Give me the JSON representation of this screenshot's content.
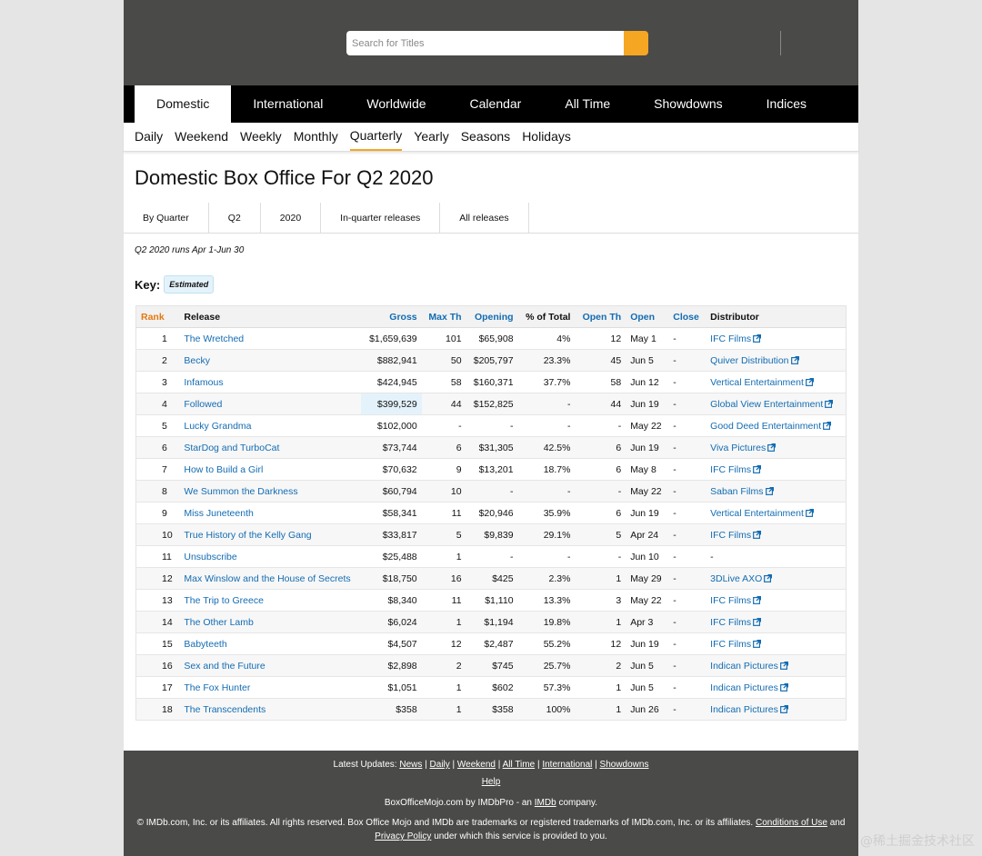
{
  "search": {
    "placeholder": "Search for Titles"
  },
  "nav_main": [
    "Domestic",
    "International",
    "Worldwide",
    "Calendar",
    "All Time",
    "Showdowns",
    "Indices"
  ],
  "nav_sub": [
    "Daily",
    "Weekend",
    "Weekly",
    "Monthly",
    "Quarterly",
    "Yearly",
    "Seasons",
    "Holidays"
  ],
  "page_title": "Domestic Box Office For Q2 2020",
  "filters": [
    "By Quarter",
    "Q2",
    "2020",
    "In-quarter releases",
    "All releases"
  ],
  "note": "Q2 2020 runs Apr 1-Jun 30",
  "key": {
    "label": "Key:",
    "badge": "Estimated"
  },
  "table": {
    "headers": [
      "Rank",
      "Release",
      "Gross",
      "Max Th",
      "Opening",
      "% of Total",
      "Open Th",
      "Open",
      "Close",
      "Distributor"
    ],
    "rows": [
      [
        "1",
        "The Wretched",
        "$1,659,639",
        "101",
        "$65,908",
        "4%",
        "12",
        "May 1",
        "-",
        "IFC Films"
      ],
      [
        "2",
        "Becky",
        "$882,941",
        "50",
        "$205,797",
        "23.3%",
        "45",
        "Jun 5",
        "-",
        "Quiver Distribution"
      ],
      [
        "3",
        "Infamous",
        "$424,945",
        "58",
        "$160,371",
        "37.7%",
        "58",
        "Jun 12",
        "-",
        "Vertical Entertainment"
      ],
      [
        "4",
        "Followed",
        "$399,529",
        "44",
        "$152,825",
        "-",
        "44",
        "Jun 19",
        "-",
        "Global View Entertainment"
      ],
      [
        "5",
        "Lucky Grandma",
        "$102,000",
        "-",
        "-",
        "-",
        "-",
        "May 22",
        "-",
        "Good Deed Entertainment"
      ],
      [
        "6",
        "StarDog and TurboCat",
        "$73,744",
        "6",
        "$31,305",
        "42.5%",
        "6",
        "Jun 19",
        "-",
        "Viva Pictures"
      ],
      [
        "7",
        "How to Build a Girl",
        "$70,632",
        "9",
        "$13,201",
        "18.7%",
        "6",
        "May 8",
        "-",
        "IFC Films"
      ],
      [
        "8",
        "We Summon the Darkness",
        "$60,794",
        "10",
        "-",
        "-",
        "-",
        "May 22",
        "-",
        "Saban Films"
      ],
      [
        "9",
        "Miss Juneteenth",
        "$58,341",
        "11",
        "$20,946",
        "35.9%",
        "6",
        "Jun 19",
        "-",
        "Vertical Entertainment"
      ],
      [
        "10",
        "True History of the Kelly Gang",
        "$33,817",
        "5",
        "$9,839",
        "29.1%",
        "5",
        "Apr 24",
        "-",
        "IFC Films"
      ],
      [
        "11",
        "Unsubscribe",
        "$25,488",
        "1",
        "-",
        "-",
        "-",
        "Jun 10",
        "-",
        "-"
      ],
      [
        "12",
        "Max Winslow and the House of Secrets",
        "$18,750",
        "16",
        "$425",
        "2.3%",
        "1",
        "May 29",
        "-",
        "3DLive AXO"
      ],
      [
        "13",
        "The Trip to Greece",
        "$8,340",
        "11",
        "$1,110",
        "13.3%",
        "3",
        "May 22",
        "-",
        "IFC Films"
      ],
      [
        "14",
        "The Other Lamb",
        "$6,024",
        "1",
        "$1,194",
        "19.8%",
        "1",
        "Apr 3",
        "-",
        "IFC Films"
      ],
      [
        "15",
        "Babyteeth",
        "$4,507",
        "12",
        "$2,487",
        "55.2%",
        "12",
        "Jun 19",
        "-",
        "IFC Films"
      ],
      [
        "16",
        "Sex and the Future",
        "$2,898",
        "2",
        "$745",
        "25.7%",
        "2",
        "Jun 5",
        "-",
        "Indican Pictures"
      ],
      [
        "17",
        "The Fox Hunter",
        "$1,051",
        "1",
        "$602",
        "57.3%",
        "1",
        "Jun 5",
        "-",
        "Indican Pictures"
      ],
      [
        "18",
        "The Transcendents",
        "$358",
        "1",
        "$358",
        "100%",
        "1",
        "Jun 26",
        "-",
        "Indican Pictures"
      ]
    ],
    "estimated_row_index": 3
  },
  "footer": {
    "updates_label": "Latest Updates:",
    "updates_links": [
      "News",
      "Daily",
      "Weekend",
      "All Time",
      "International",
      "Showdowns"
    ],
    "help": "Help",
    "brand_prefix": "BoxOfficeMojo.com by IMDbPro - an",
    "brand_link": "IMDb",
    "brand_suffix": "company.",
    "copyright": "© IMDb.com, Inc. or its affiliates. All rights reserved. Box Office Mojo and IMDb are trademarks or registered trademarks of IMDb.com, Inc. or its affiliates.",
    "conditions_link": "Conditions of Use",
    "and_text": "and",
    "privacy_link": "Privacy Policy",
    "tail_text": "under which this service is provided to you."
  },
  "watermark": "@稀土掘金技术社区",
  "colors": {
    "accent": "#f5a623",
    "link": "#136cb2",
    "rank": "#e47911",
    "header_bg": "#4a4a48",
    "estimated_bg": "#e4f3fb"
  }
}
